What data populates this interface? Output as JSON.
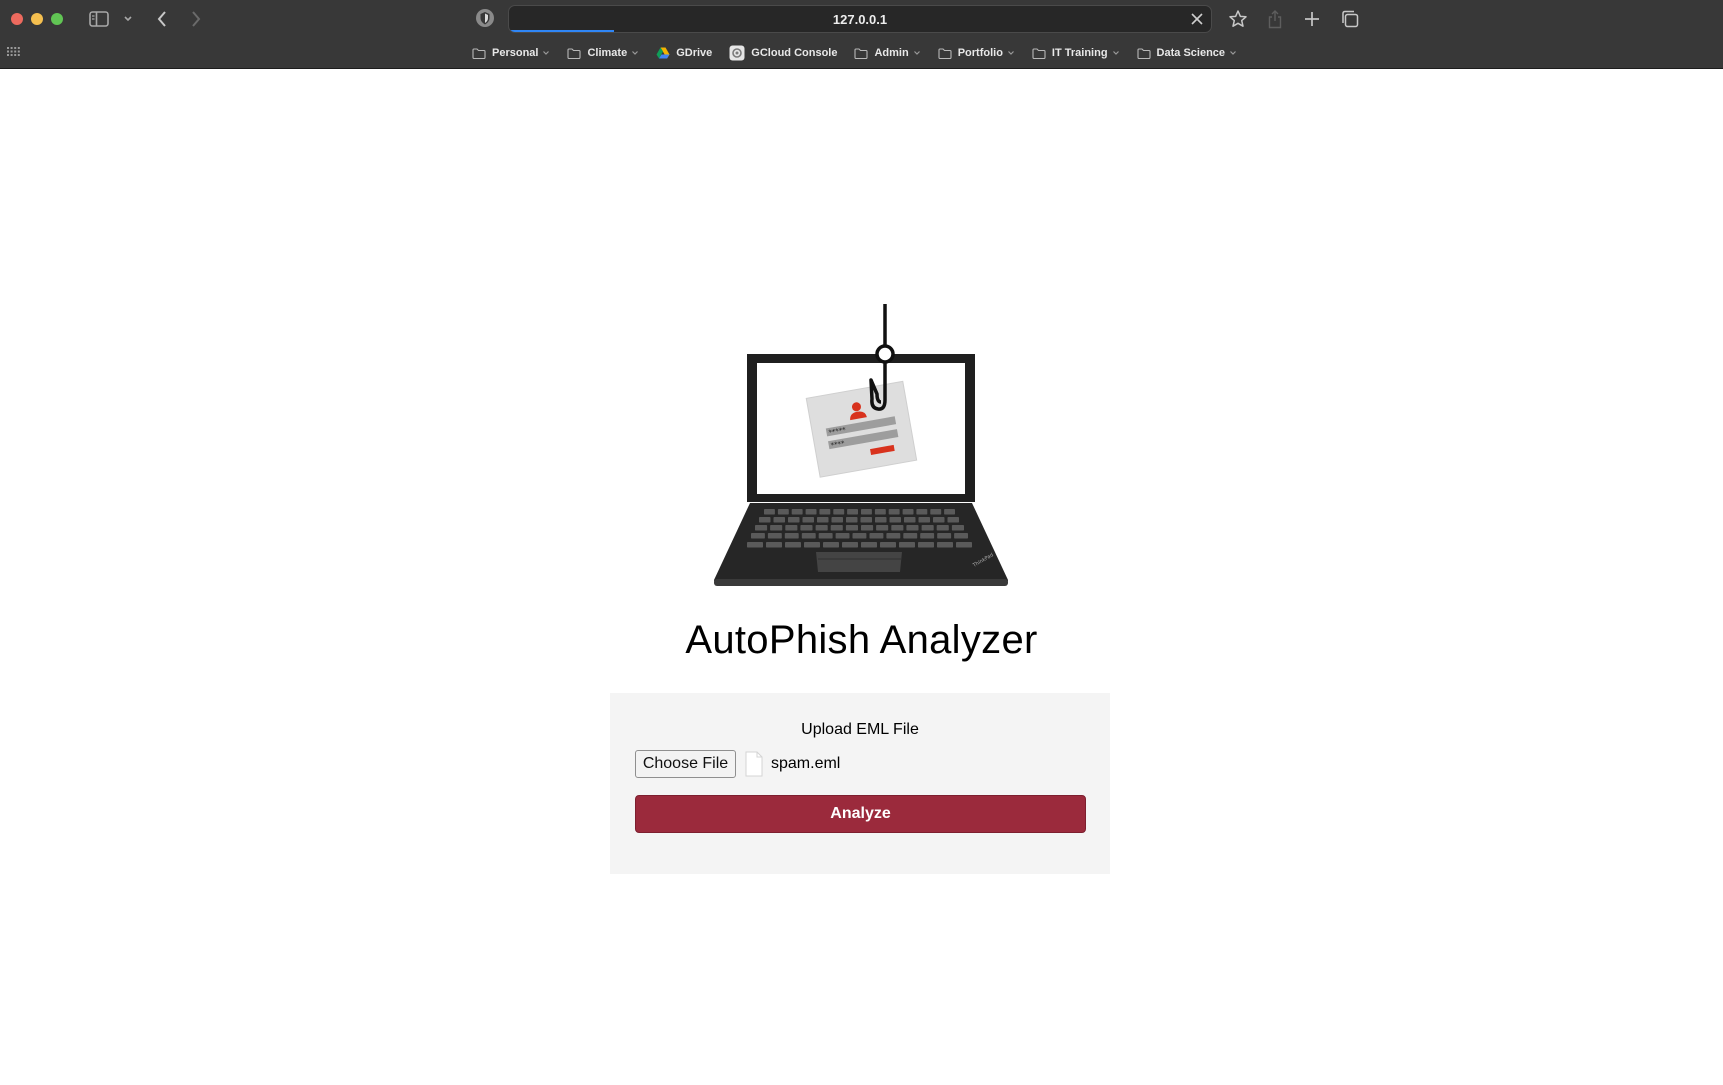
{
  "browser": {
    "url": "127.0.0.1",
    "load_progress": 0.15,
    "bookmarks": [
      {
        "label": "Personal",
        "icon": "folder-icon",
        "has_menu": true
      },
      {
        "label": "Climate",
        "icon": "folder-icon",
        "has_menu": true
      },
      {
        "label": "GDrive",
        "icon": "google-drive-icon",
        "has_menu": false
      },
      {
        "label": "GCloud Console",
        "icon": "gcloud-icon",
        "has_menu": false
      },
      {
        "label": "Admin",
        "icon": "folder-icon",
        "has_menu": true
      },
      {
        "label": "Portfolio",
        "icon": "folder-icon",
        "has_menu": true
      },
      {
        "label": "IT Training",
        "icon": "folder-icon",
        "has_menu": true
      },
      {
        "label": "Data Science",
        "icon": "folder-icon",
        "has_menu": true
      }
    ]
  },
  "page": {
    "title": "AutoPhish Analyzer",
    "hero_icon": "phishing-laptop-illustration",
    "form": {
      "label": "Upload EML File",
      "choose_button": "Choose File",
      "file_name": "spam.eml",
      "submit_button": "Analyze"
    }
  },
  "colors": {
    "accent": "#9b2a3c",
    "card_bg": "#f4f4f4",
    "chrome_bg": "#383838",
    "progress": "#2f86f6"
  }
}
